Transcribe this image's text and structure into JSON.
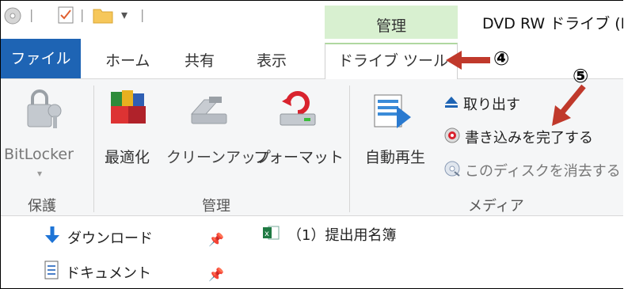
{
  "titlebar": {
    "manage_tab": "管理",
    "window_title": "DVD RW ドライブ (D"
  },
  "tabs": {
    "file": "ファイル",
    "home": "ホーム",
    "share": "共有",
    "view": "表示",
    "drive_tools": "ドライブ ツール"
  },
  "ribbon": {
    "protect": {
      "bitlocker_label": "BitLocker",
      "group_label": "保護"
    },
    "manage": {
      "optimize_label": "最適化",
      "cleanup_label": "クリーンアップ",
      "format_label": "フォーマット",
      "group_label": "管理"
    },
    "media": {
      "autoplay_label": "自動再生",
      "eject_label": "取り出す",
      "finish_burning_label": "書き込みを完了する",
      "erase_disc_label": "このディスクを消去する",
      "group_label": "メディア"
    }
  },
  "nav": {
    "items": [
      {
        "label": "ダウンロード"
      },
      {
        "label": "ドキュメント"
      }
    ],
    "file_item": "（1）提出用名簿"
  },
  "annotations": {
    "num4": "④",
    "num5": "⑤",
    "arrow_color": "#c0392b"
  }
}
